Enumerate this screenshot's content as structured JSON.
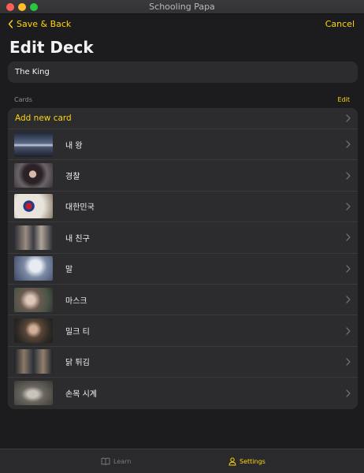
{
  "window": {
    "title": "Schooling Papa"
  },
  "nav": {
    "back_label": "Save & Back",
    "cancel_label": "Cancel"
  },
  "page": {
    "title": "Edit Deck"
  },
  "deck": {
    "name": "The King"
  },
  "cards_section": {
    "label": "Cards",
    "edit_label": "Edit"
  },
  "cards": {
    "add_label": "Add new card",
    "items": [
      {
        "label": "내 왕"
      },
      {
        "label": "경찰"
      },
      {
        "label": "대한민국"
      },
      {
        "label": "내 친구"
      },
      {
        "label": "말"
      },
      {
        "label": "마스크"
      },
      {
        "label": "밀크 티"
      },
      {
        "label": "닭 튀김"
      },
      {
        "label": "손목 시계"
      }
    ]
  },
  "tabs": {
    "learn_label": "Learn",
    "settings_label": "Settings"
  },
  "colors": {
    "accent": "#ffd60a",
    "background": "#1c1c1e",
    "surface": "#2c2c2e"
  },
  "icons": {
    "back": "chevron-left-icon",
    "row": "chevron-right-icon",
    "learn": "book-icon",
    "settings": "person-icon"
  }
}
